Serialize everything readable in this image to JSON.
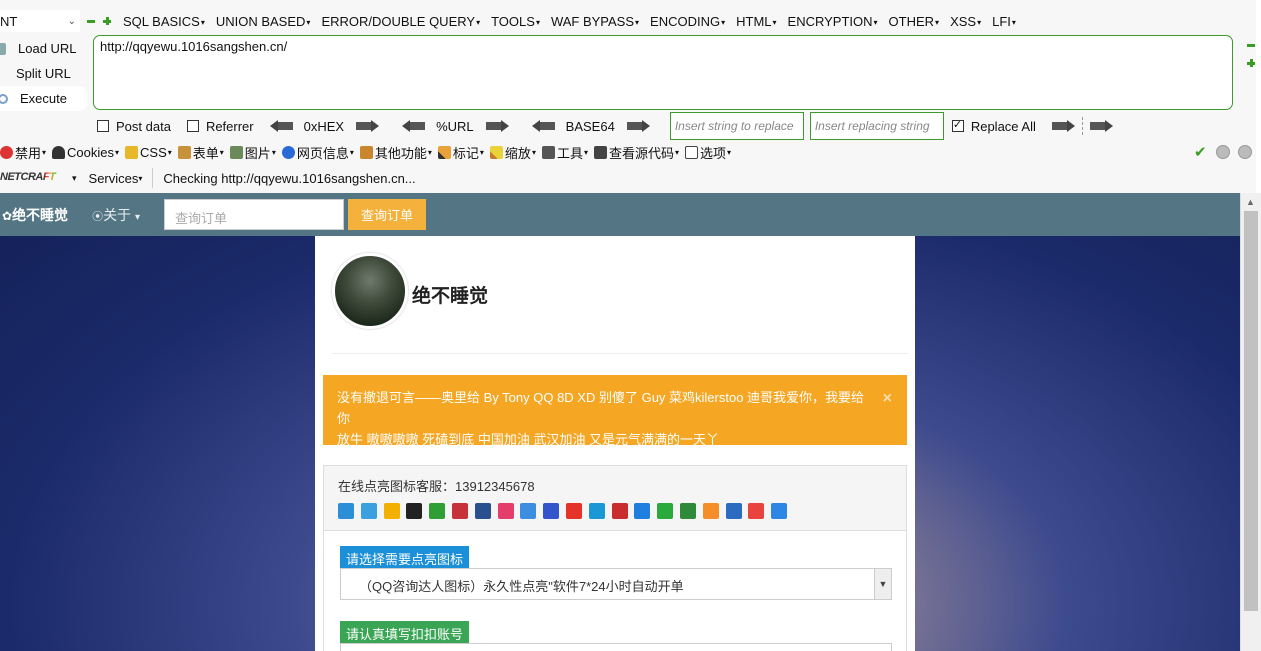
{
  "hackbar": {
    "dropdown_value": "NT",
    "menus": [
      "SQL BASICS",
      "UNION BASED",
      "ERROR/DOUBLE QUERY",
      "TOOLS",
      "WAF BYPASS",
      "ENCODING",
      "HTML",
      "ENCRYPTION",
      "OTHER",
      "XSS",
      "LFI"
    ],
    "actions": {
      "load": "Load URL",
      "split": "Split URL",
      "execute": "Execute"
    },
    "url_value": "http://qqyewu.1016sangshen.cn/",
    "post_data_label": "Post data",
    "referrer_label": "Referrer",
    "hex_label": "0xHEX",
    "url_enc_label": "%URL",
    "base64_label": "BASE64",
    "insert_placeholder": "Insert string to replace",
    "replacing_placeholder": "Insert replacing string",
    "replace_all_label": "Replace All",
    "replace_all_checked": true
  },
  "toolbar": {
    "items": [
      "禁用",
      "Cookies",
      "CSS",
      "表单",
      "图片",
      "网页信息",
      "其他功能",
      "标记",
      "缩放",
      "工具",
      "查看源代码",
      "选项"
    ]
  },
  "netcraft": {
    "logo": "NETCRAFT",
    "services_label": "Services",
    "status": "Checking http://qqyewu.1016sangshen.cn..."
  },
  "site": {
    "brand": "绝不睡觉",
    "about": "关于",
    "search_placeholder": "查询订单",
    "search_button": "查询订单",
    "name": "绝不睡觉",
    "notice_line1": "没有撤退可言——奥里给 By Tony QQ 8D XD 别傻了 Guy 菜鸡kilerstoo 迪哥我爱你，我要给你",
    "notice_line2": "放牛 嗷嗷嗷嗷 死磕到底 中国加油 武汉加油 又是元气满满的一天丫",
    "close_glyph": "×",
    "service_label": "在线点亮图标客服：",
    "service_phone": "13912345678",
    "icon_colors": [
      "#2d8ed8",
      "#3aa0e0",
      "#f3b000",
      "#222222",
      "#2f9e34",
      "#c6313a",
      "#2a4f8f",
      "#e43d6b",
      "#3d8ee0",
      "#3355cc",
      "#e5332a",
      "#1a97d5",
      "#c92d2d",
      "#1e7fe0",
      "#2aaa3b",
      "#2f8a3a",
      "#f58e28",
      "#2b6cc0",
      "#e8433c",
      "#2d86e4"
    ],
    "select_label": "请选择需要点亮图标",
    "select_value": "（QQ咨询达人图标）永久性点亮\"软件7*24小时自动开单",
    "account_label": "请认真填写扣扣账号"
  }
}
